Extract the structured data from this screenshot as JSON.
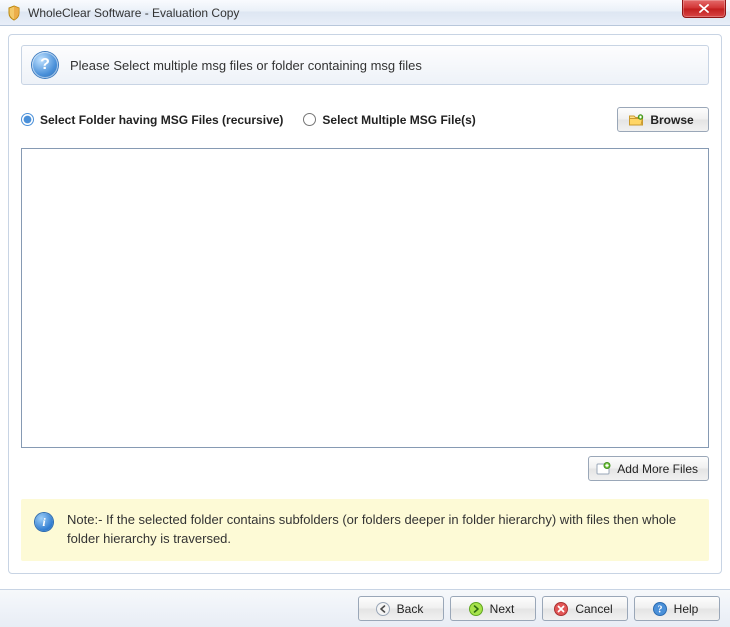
{
  "window": {
    "title": "WholeClear Software - Evaluation Copy"
  },
  "header": {
    "instruction": "Please Select multiple msg files or folder containing msg files"
  },
  "options": {
    "folder_label": "Select Folder having MSG Files (recursive)",
    "files_label": "Select Multiple MSG File(s)",
    "selected": "folder"
  },
  "buttons": {
    "browse": "Browse",
    "add_more": "Add More Files",
    "back": "Back",
    "next": "Next",
    "cancel": "Cancel",
    "help": "Help"
  },
  "note": {
    "text": "Note:- If the selected folder contains subfolders (or folders deeper in folder hierarchy) with files then whole folder hierarchy is traversed."
  }
}
